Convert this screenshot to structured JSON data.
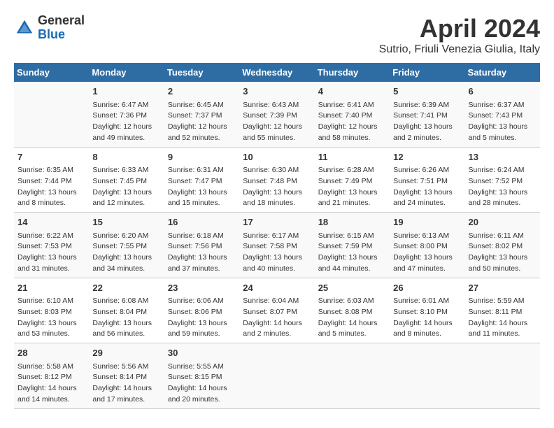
{
  "header": {
    "logo_general": "General",
    "logo_blue": "Blue",
    "title": "April 2024",
    "subtitle": "Sutrio, Friuli Venezia Giulia, Italy"
  },
  "weekdays": [
    "Sunday",
    "Monday",
    "Tuesday",
    "Wednesday",
    "Thursday",
    "Friday",
    "Saturday"
  ],
  "weeks": [
    [
      {
        "day": "",
        "info": ""
      },
      {
        "day": "1",
        "info": "Sunrise: 6:47 AM\nSunset: 7:36 PM\nDaylight: 12 hours\nand 49 minutes."
      },
      {
        "day": "2",
        "info": "Sunrise: 6:45 AM\nSunset: 7:37 PM\nDaylight: 12 hours\nand 52 minutes."
      },
      {
        "day": "3",
        "info": "Sunrise: 6:43 AM\nSunset: 7:39 PM\nDaylight: 12 hours\nand 55 minutes."
      },
      {
        "day": "4",
        "info": "Sunrise: 6:41 AM\nSunset: 7:40 PM\nDaylight: 12 hours\nand 58 minutes."
      },
      {
        "day": "5",
        "info": "Sunrise: 6:39 AM\nSunset: 7:41 PM\nDaylight: 13 hours\nand 2 minutes."
      },
      {
        "day": "6",
        "info": "Sunrise: 6:37 AM\nSunset: 7:43 PM\nDaylight: 13 hours\nand 5 minutes."
      }
    ],
    [
      {
        "day": "7",
        "info": "Sunrise: 6:35 AM\nSunset: 7:44 PM\nDaylight: 13 hours\nand 8 minutes."
      },
      {
        "day": "8",
        "info": "Sunrise: 6:33 AM\nSunset: 7:45 PM\nDaylight: 13 hours\nand 12 minutes."
      },
      {
        "day": "9",
        "info": "Sunrise: 6:31 AM\nSunset: 7:47 PM\nDaylight: 13 hours\nand 15 minutes."
      },
      {
        "day": "10",
        "info": "Sunrise: 6:30 AM\nSunset: 7:48 PM\nDaylight: 13 hours\nand 18 minutes."
      },
      {
        "day": "11",
        "info": "Sunrise: 6:28 AM\nSunset: 7:49 PM\nDaylight: 13 hours\nand 21 minutes."
      },
      {
        "day": "12",
        "info": "Sunrise: 6:26 AM\nSunset: 7:51 PM\nDaylight: 13 hours\nand 24 minutes."
      },
      {
        "day": "13",
        "info": "Sunrise: 6:24 AM\nSunset: 7:52 PM\nDaylight: 13 hours\nand 28 minutes."
      }
    ],
    [
      {
        "day": "14",
        "info": "Sunrise: 6:22 AM\nSunset: 7:53 PM\nDaylight: 13 hours\nand 31 minutes."
      },
      {
        "day": "15",
        "info": "Sunrise: 6:20 AM\nSunset: 7:55 PM\nDaylight: 13 hours\nand 34 minutes."
      },
      {
        "day": "16",
        "info": "Sunrise: 6:18 AM\nSunset: 7:56 PM\nDaylight: 13 hours\nand 37 minutes."
      },
      {
        "day": "17",
        "info": "Sunrise: 6:17 AM\nSunset: 7:58 PM\nDaylight: 13 hours\nand 40 minutes."
      },
      {
        "day": "18",
        "info": "Sunrise: 6:15 AM\nSunset: 7:59 PM\nDaylight: 13 hours\nand 44 minutes."
      },
      {
        "day": "19",
        "info": "Sunrise: 6:13 AM\nSunset: 8:00 PM\nDaylight: 13 hours\nand 47 minutes."
      },
      {
        "day": "20",
        "info": "Sunrise: 6:11 AM\nSunset: 8:02 PM\nDaylight: 13 hours\nand 50 minutes."
      }
    ],
    [
      {
        "day": "21",
        "info": "Sunrise: 6:10 AM\nSunset: 8:03 PM\nDaylight: 13 hours\nand 53 minutes."
      },
      {
        "day": "22",
        "info": "Sunrise: 6:08 AM\nSunset: 8:04 PM\nDaylight: 13 hours\nand 56 minutes."
      },
      {
        "day": "23",
        "info": "Sunrise: 6:06 AM\nSunset: 8:06 PM\nDaylight: 13 hours\nand 59 minutes."
      },
      {
        "day": "24",
        "info": "Sunrise: 6:04 AM\nSunset: 8:07 PM\nDaylight: 14 hours\nand 2 minutes."
      },
      {
        "day": "25",
        "info": "Sunrise: 6:03 AM\nSunset: 8:08 PM\nDaylight: 14 hours\nand 5 minutes."
      },
      {
        "day": "26",
        "info": "Sunrise: 6:01 AM\nSunset: 8:10 PM\nDaylight: 14 hours\nand 8 minutes."
      },
      {
        "day": "27",
        "info": "Sunrise: 5:59 AM\nSunset: 8:11 PM\nDaylight: 14 hours\nand 11 minutes."
      }
    ],
    [
      {
        "day": "28",
        "info": "Sunrise: 5:58 AM\nSunset: 8:12 PM\nDaylight: 14 hours\nand 14 minutes."
      },
      {
        "day": "29",
        "info": "Sunrise: 5:56 AM\nSunset: 8:14 PM\nDaylight: 14 hours\nand 17 minutes."
      },
      {
        "day": "30",
        "info": "Sunrise: 5:55 AM\nSunset: 8:15 PM\nDaylight: 14 hours\nand 20 minutes."
      },
      {
        "day": "",
        "info": ""
      },
      {
        "day": "",
        "info": ""
      },
      {
        "day": "",
        "info": ""
      },
      {
        "day": "",
        "info": ""
      }
    ]
  ]
}
